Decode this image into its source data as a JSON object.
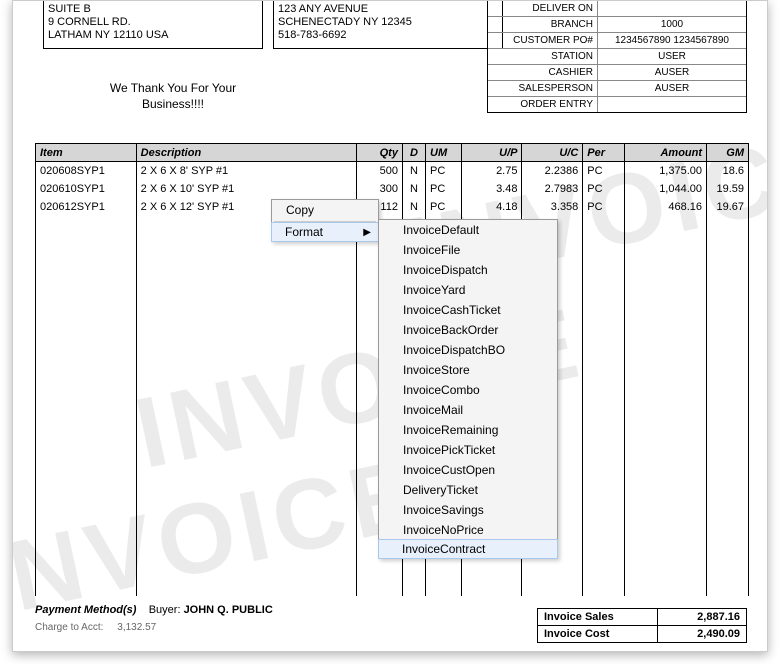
{
  "watermark": "INVOICE",
  "address_left": {
    "l1": "SUITE B",
    "l2": "9 CORNELL RD.",
    "l3": "LATHAM  NY  12110   USA"
  },
  "address_mid": {
    "l1": "123 ANY AVENUE",
    "l2": "SCHENECTADY  NY  12345",
    "l3": "518-783-6692"
  },
  "thanks": {
    "l1": "We Thank You For Your",
    "l2": "Business!!!!"
  },
  "header_info": [
    {
      "k": "DELIVER ON",
      "v": ""
    },
    {
      "k": "BRANCH",
      "v": "1000"
    },
    {
      "k": "CUSTOMER PO#",
      "v": "1234567890 1234567890"
    },
    {
      "k": "STATION",
      "v": "USER"
    },
    {
      "k": "CASHIER",
      "v": "AUSER"
    },
    {
      "k": "SALESPERSON",
      "v": "AUSER"
    },
    {
      "k": "ORDER ENTRY",
      "v": ""
    }
  ],
  "columns": {
    "item": "Item",
    "desc": "Description",
    "qty": "Qty",
    "d": "D",
    "um": "UM",
    "up": "U/P",
    "uc": "U/C",
    "per": "Per",
    "amt": "Amount",
    "gm": "GM"
  },
  "rows": [
    {
      "item": "020608SYP1",
      "desc": "2 X 6 X 8' SYP #1",
      "qty": "500",
      "d": "N",
      "um": "PC",
      "up": "2.75",
      "uc": "2.2386",
      "per": "PC",
      "amt": "1,375.00",
      "gm": "18.6"
    },
    {
      "item": "020610SYP1",
      "desc": "2 X 6 X 10' SYP #1",
      "qty": "300",
      "d": "N",
      "um": "PC",
      "up": "3.48",
      "uc": "2.7983",
      "per": "PC",
      "amt": "1,044.00",
      "gm": "19.59"
    },
    {
      "item": "020612SYP1",
      "desc": "2 X 6 X 12' SYP #1",
      "qty": "112",
      "d": "N",
      "um": "PC",
      "up": "4.18",
      "uc": "3.358",
      "per": "PC",
      "amt": "468.16",
      "gm": "19.67"
    }
  ],
  "payment": {
    "label": "Payment Method(s)",
    "buyer_label": "Buyer:",
    "buyer": "JOHN Q. PUBLIC",
    "charge_label": "Charge to Acct:",
    "charge_val": "3,132.57"
  },
  "totals": {
    "sales_label": "Invoice Sales",
    "sales_val": "2,887.16",
    "cost_label": "Invoice Cost",
    "cost_val": "2,490.09"
  },
  "ctx1": {
    "copy": "Copy",
    "format": "Format"
  },
  "ctx2": [
    "InvoiceDefault",
    "InvoiceFile",
    "InvoiceDispatch",
    "InvoiceYard",
    "InvoiceCashTicket",
    "InvoiceBackOrder",
    "InvoiceDispatchBO",
    "InvoiceStore",
    "InvoiceCombo",
    "InvoiceMail",
    "InvoiceRemaining",
    "InvoicePickTicket",
    "InvoiceCustOpen",
    "DeliveryTicket",
    "InvoiceSavings",
    "InvoiceNoPrice",
    "InvoiceContract"
  ],
  "ctx2_hover_index": 16
}
